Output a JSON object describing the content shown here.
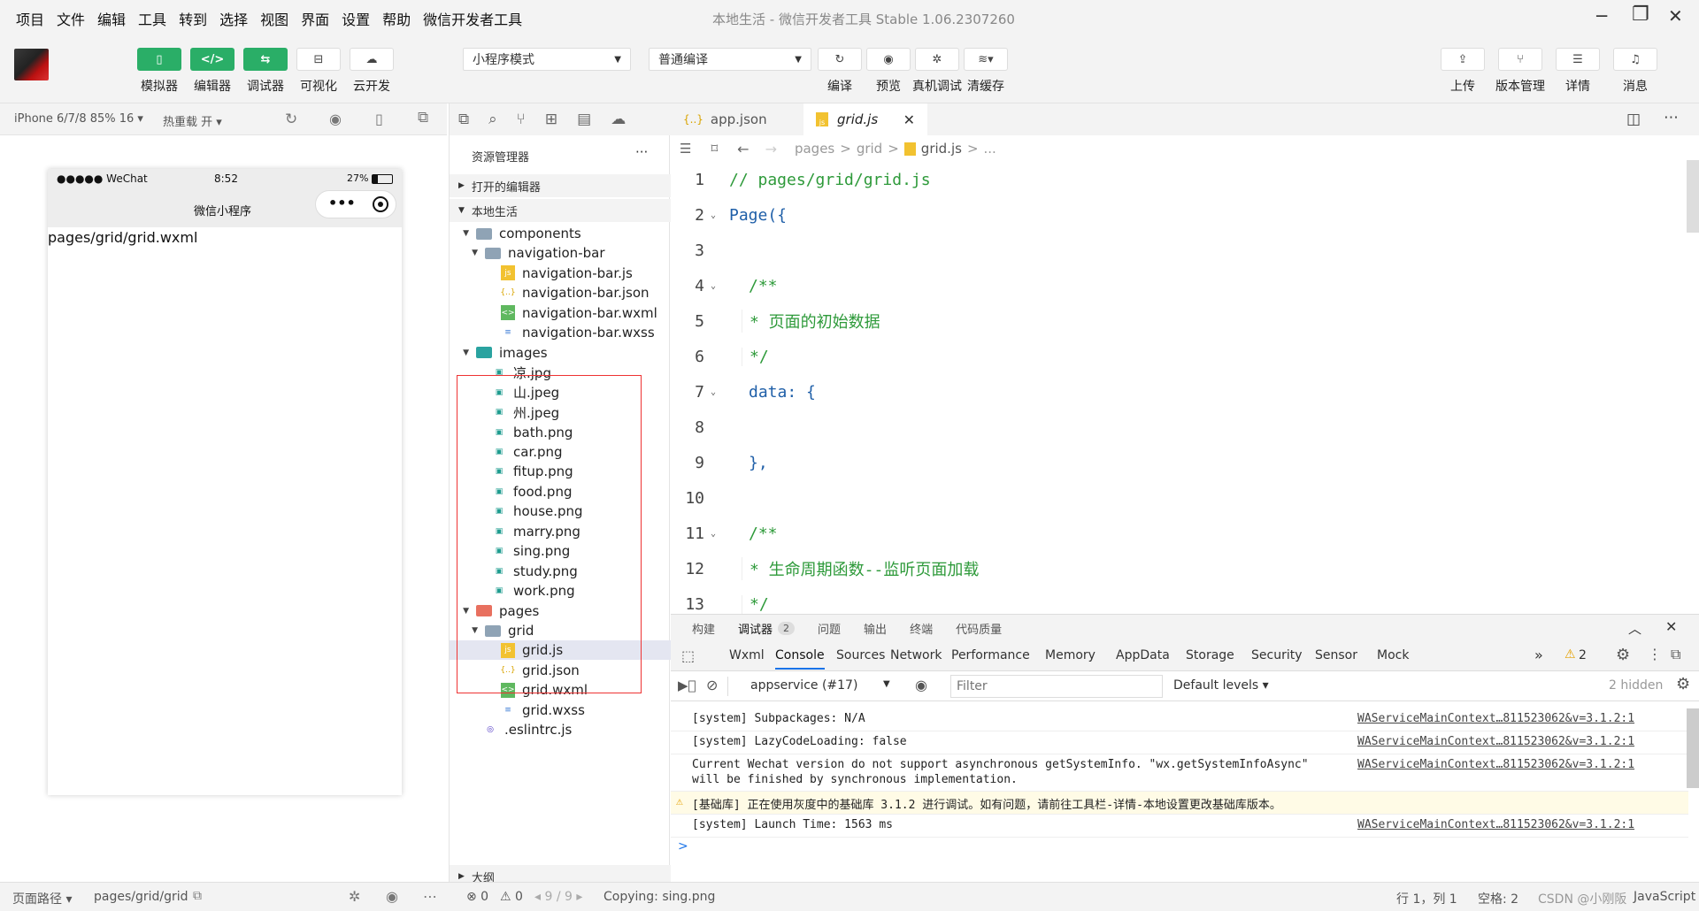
{
  "menubar": {
    "items": [
      "项目",
      "文件",
      "编辑",
      "工具",
      "转到",
      "选择",
      "视图",
      "界面",
      "设置",
      "帮助",
      "微信开发者工具"
    ],
    "window_title": "本地生活 - 微信开发者工具 Stable 1.06.2307260"
  },
  "toolbar": {
    "left_buttons": [
      {
        "label": "模拟器",
        "icon": "phone-icon"
      },
      {
        "label": "编辑器",
        "icon": "code-icon"
      },
      {
        "label": "调试器",
        "icon": "debug-icon"
      },
      {
        "label": "可视化",
        "icon": "layout-icon"
      },
      {
        "label": "云开发",
        "icon": "cloud-icon"
      }
    ],
    "mode_select": "小程序模式",
    "compile_select": "普通编译",
    "mid_buttons": [
      {
        "label": "编译",
        "icon": "refresh-icon"
      },
      {
        "label": "预览",
        "icon": "eye-icon"
      },
      {
        "label": "真机调试",
        "icon": "bug-icon"
      },
      {
        "label": "清缓存",
        "icon": "layers-icon"
      }
    ],
    "right_buttons": [
      {
        "label": "上传",
        "icon": "upload-icon"
      },
      {
        "label": "版本管理",
        "icon": "branch-icon"
      },
      {
        "label": "详情",
        "icon": "menu-icon"
      },
      {
        "label": "消息",
        "icon": "bell-icon"
      }
    ]
  },
  "simulator": {
    "device": "iPhone 6/7/8 85% 16 ▾",
    "hot_reload": "热重载 开 ▾",
    "status_carrier": "●●●●● WeChat",
    "status_time": "8:52",
    "status_battery": "27%",
    "nav_title": "微信小程序",
    "page_text": "pages/grid/grid.wxml"
  },
  "explorer": {
    "title": "资源管理器",
    "more": "···",
    "open_editors": "打开的编辑器",
    "project": "本地生活",
    "outline": "大纲",
    "tree": [
      {
        "label": "components",
        "type": "folder",
        "depth": 1,
        "open": true
      },
      {
        "label": "navigation-bar",
        "type": "folder",
        "depth": 2,
        "open": true
      },
      {
        "label": "navigation-bar.js",
        "type": "js",
        "depth": 3
      },
      {
        "label": "navigation-bar.json",
        "type": "json",
        "depth": 3
      },
      {
        "label": "navigation-bar.wxml",
        "type": "wxml",
        "depth": 3
      },
      {
        "label": "navigation-bar.wxss",
        "type": "wxss",
        "depth": 3
      },
      {
        "label": "images",
        "type": "imgfolder",
        "depth": 1,
        "open": true
      },
      {
        "label": "凉.jpg",
        "type": "img",
        "depth": 2
      },
      {
        "label": "山.jpeg",
        "type": "img",
        "depth": 2
      },
      {
        "label": "州.jpeg",
        "type": "img",
        "depth": 2
      },
      {
        "label": "bath.png",
        "type": "img",
        "depth": 2
      },
      {
        "label": "car.png",
        "type": "img",
        "depth": 2
      },
      {
        "label": "fitup.png",
        "type": "img",
        "depth": 2
      },
      {
        "label": "food.png",
        "type": "img",
        "depth": 2
      },
      {
        "label": "house.png",
        "type": "img",
        "depth": 2
      },
      {
        "label": "marry.png",
        "type": "img",
        "depth": 2
      },
      {
        "label": "sing.png",
        "type": "img",
        "depth": 2
      },
      {
        "label": "study.png",
        "type": "img",
        "depth": 2
      },
      {
        "label": "work.png",
        "type": "img",
        "depth": 2
      },
      {
        "label": "pages",
        "type": "pagesfolder",
        "depth": 1,
        "open": true
      },
      {
        "label": "grid",
        "type": "folder",
        "depth": 2,
        "open": true
      },
      {
        "label": "grid.js",
        "type": "js",
        "depth": 3,
        "selected": true
      },
      {
        "label": "grid.json",
        "type": "json",
        "depth": 3
      },
      {
        "label": "grid.wxml",
        "type": "wxml",
        "depth": 3
      },
      {
        "label": "grid.wxss",
        "type": "wxss",
        "depth": 3
      },
      {
        "label": ".eslintrc.js",
        "type": "eslint",
        "depth": 1
      }
    ]
  },
  "editor": {
    "tabs": [
      {
        "label": "app.json",
        "icon": "{..}",
        "active": false
      },
      {
        "label": "grid.js",
        "icon": "js",
        "active": true
      }
    ],
    "breadcrumb": [
      "pages",
      ">",
      "grid",
      ">",
      "grid.js",
      ">",
      "..."
    ],
    "lines": [
      {
        "n": "1",
        "text": "// pages/grid/grid.js",
        "kind": "comment",
        "indent": 0
      },
      {
        "n": "2",
        "text": "Page({",
        "kind": "code",
        "indent": 0,
        "fold": true
      },
      {
        "n": "3",
        "text": "",
        "kind": "code",
        "indent": 0
      },
      {
        "n": "4",
        "text": "/**",
        "kind": "comment",
        "indent": 1,
        "fold": true
      },
      {
        "n": "5",
        "text": "* 页面的初始数据",
        "kind": "comment",
        "indent": 1
      },
      {
        "n": "6",
        "text": "*/",
        "kind": "comment",
        "indent": 1
      },
      {
        "n": "7",
        "text": "data: {",
        "kind": "code",
        "indent": 1,
        "fold": true
      },
      {
        "n": "8",
        "text": "",
        "kind": "code",
        "indent": 0
      },
      {
        "n": "9",
        "text": "},",
        "kind": "code",
        "indent": 1
      },
      {
        "n": "10",
        "text": "",
        "kind": "code",
        "indent": 0
      },
      {
        "n": "11",
        "text": "/**",
        "kind": "comment",
        "indent": 1,
        "fold": true
      },
      {
        "n": "12",
        "text": "* 生命周期函数--监听页面加载",
        "kind": "comment",
        "indent": 1
      },
      {
        "n": "13",
        "text": "*/",
        "kind": "comment",
        "indent": 1
      }
    ]
  },
  "devtools": {
    "top_tabs": [
      "构建",
      "调试器",
      "问题",
      "输出",
      "终端",
      "代码质量"
    ],
    "debugger_badge": "2",
    "panel_tabs": [
      "Wxml",
      "Console",
      "Sources",
      "Network",
      "Performance",
      "Memory",
      "AppData",
      "Storage",
      "Security",
      "Sensor",
      "Mock"
    ],
    "more_tabs": "»",
    "warn_count": "2",
    "context": "appservice (#17)",
    "filter_placeholder": "Filter",
    "levels": "Default levels ▾",
    "hidden": "2 hidden",
    "logs": [
      {
        "text": "[system] Subpackages: N/A",
        "src": "WAServiceMainContext…811523062&v=3.1.2:1",
        "warn": false
      },
      {
        "text": "[system] LazyCodeLoading: false",
        "src": "WAServiceMainContext…811523062&v=3.1.2:1",
        "warn": false
      },
      {
        "text": "Current Wechat version do not support asynchronous getSystemInfo. \"wx.getSystemInfoAsync\"",
        "text2": "will be finished by synchronous implementation.",
        "src": "WAServiceMainContext…811523062&v=3.1.2:1",
        "warn": false
      },
      {
        "text": "[基础库] 正在使用灰度中的基础库 3.1.2 进行调试。如有问题，请前往工具栏-详情-本地设置更改基础库版本。",
        "src": "",
        "warn": true
      },
      {
        "text": "[system] Launch Time: 1563 ms",
        "src": "WAServiceMainContext…811523062&v=3.1.2:1",
        "warn": false
      }
    ],
    "prompt": ">"
  },
  "status": {
    "page_path_label": "页面路径 ▾",
    "page_path": "pages/grid/grid",
    "errors": "⊗ 0",
    "warnings": "⚠ 0",
    "nav": "◂ 9 / 9 ▸",
    "copying": "Copying: sing.png",
    "position": "行 1，列 1",
    "spaces": "空格: 2",
    "lang": "JavaScript",
    "watermark": "CSDN @小刚阪"
  },
  "colors": {
    "green": "#2aae67",
    "comment": "#2e9a3a",
    "keyword": "#1f5fa8",
    "selected_row": "#e4e6f1",
    "redbox": "#e33333"
  }
}
